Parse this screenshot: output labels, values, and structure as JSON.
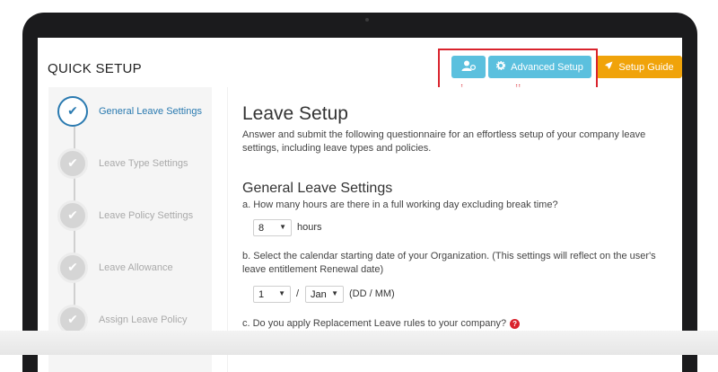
{
  "page": {
    "title": "QUICK SETUP"
  },
  "header": {
    "user_icon": "user-settings-icon",
    "advanced_label": "Advanced Setup",
    "advanced_icon": "gear-icon",
    "guide_label": "Setup Guide",
    "guide_icon": "rocket-icon",
    "annotation_i": "i",
    "annotation_ii": "ii",
    "annotation_color": "#d9232d"
  },
  "steps": [
    {
      "label": "General Leave Settings",
      "active": true
    },
    {
      "label": "Leave Type Settings",
      "active": false
    },
    {
      "label": "Leave Policy Settings",
      "active": false
    },
    {
      "label": "Leave Allowance",
      "active": false
    },
    {
      "label": "Assign Leave Policy",
      "active": false
    }
  ],
  "main": {
    "heading": "Leave Setup",
    "intro": "Answer and submit the following questionnaire for an effortless setup of your company leave settings, including leave types and policies.",
    "section_title": "General Leave Settings",
    "question_a": "a. How many hours are there in a full working day excluding break time?",
    "hours_value": "8",
    "hours_unit": "hours",
    "question_b": "b. Select the calendar starting date of your Organization. (This settings will reflect on the user's leave entitlement Renewal date)",
    "day_value": "1",
    "slash": "/",
    "month_value": "Jan",
    "date_format": "(DD / MM)",
    "question_c": "c. Do you apply Replacement Leave rules to your company?"
  },
  "colors": {
    "primary_button": "#5bc0de",
    "guide_button": "#f0a30a",
    "active_step": "#2a7ab0"
  }
}
